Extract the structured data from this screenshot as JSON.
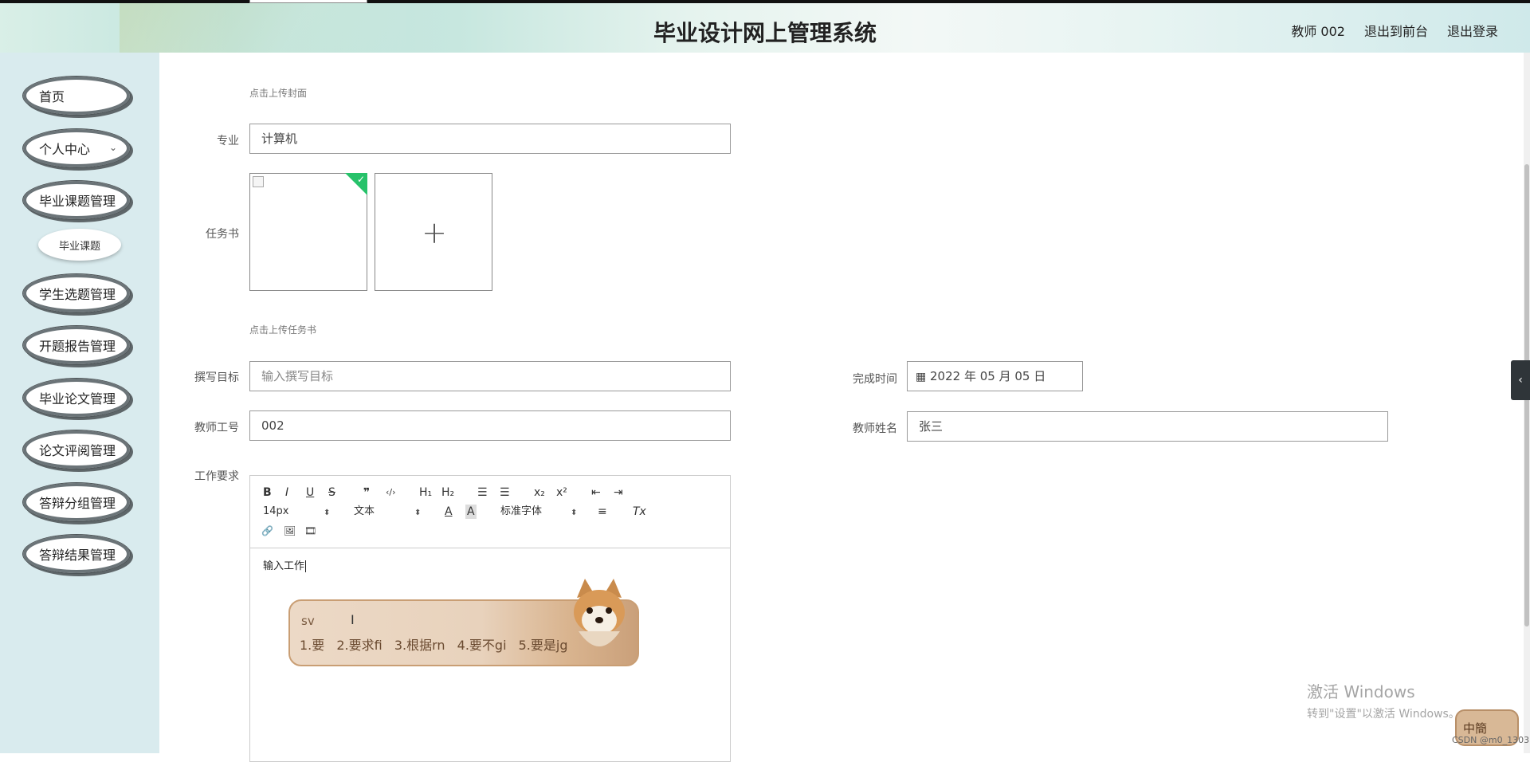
{
  "header": {
    "title": "毕业设计网上管理系统",
    "user_label": "教师 002",
    "back_label": "退出到前台",
    "logout_label": "退出登录"
  },
  "sidebar": {
    "items": [
      {
        "label": "首页"
      },
      {
        "label": "个人中心"
      },
      {
        "label": "毕业课题管理"
      },
      {
        "label": "学生选题管理"
      },
      {
        "label": "开题报告管理"
      },
      {
        "label": "毕业论文管理"
      },
      {
        "label": "论文评阅管理"
      },
      {
        "label": "答辩分组管理"
      },
      {
        "label": "答辩结果管理"
      }
    ],
    "submenu": {
      "label": "毕业课题"
    },
    "chevron": "chevron-down-icon"
  },
  "form": {
    "cover_hint": "点击上传封面",
    "major_label": "专业",
    "major_value": "计算机",
    "task_label": "任务书",
    "task_hint": "点击上传任务书",
    "goal_label": "撰写目标",
    "goal_placeholder": "输入撰写目标",
    "finish_label": "完成时间",
    "finish_value": "2022 年 05 月 05 日",
    "teacher_id_label": "教师工号",
    "teacher_id_value": "002",
    "teacher_name_label": "教师姓名",
    "teacher_name_value": "张三",
    "work_label": "工作要求"
  },
  "editor": {
    "toolbar": {
      "bold": "B",
      "italic": "I",
      "underline": "U",
      "strike": "S",
      "quote": "❞",
      "code": "‹/›",
      "h1": "H₁",
      "h2": "H₂",
      "ol": "☰",
      "ul": "☰",
      "sub": "x₂",
      "sup": "x²",
      "outdent": "⇤",
      "indent": "⇥",
      "size": "14px",
      "format": "文本",
      "font": "标准字体",
      "color": "A",
      "bg": "A",
      "align": "≡",
      "clear": "Tx",
      "link": "🔗",
      "image": "🖼",
      "video": "🎞"
    },
    "content": "输入工作"
  },
  "ime": {
    "code": "sv",
    "candidates": [
      "1.要",
      "2.要求fi",
      "3.根据rn",
      "4.要不gi",
      "5.要是jg"
    ],
    "status_label": "中簡"
  },
  "side_tab": "‹",
  "watermark": {
    "line1": "激活 Windows",
    "line2": "转到\"设置\"以激活 Windows。"
  },
  "csdn": "CSDN @m0_1303"
}
